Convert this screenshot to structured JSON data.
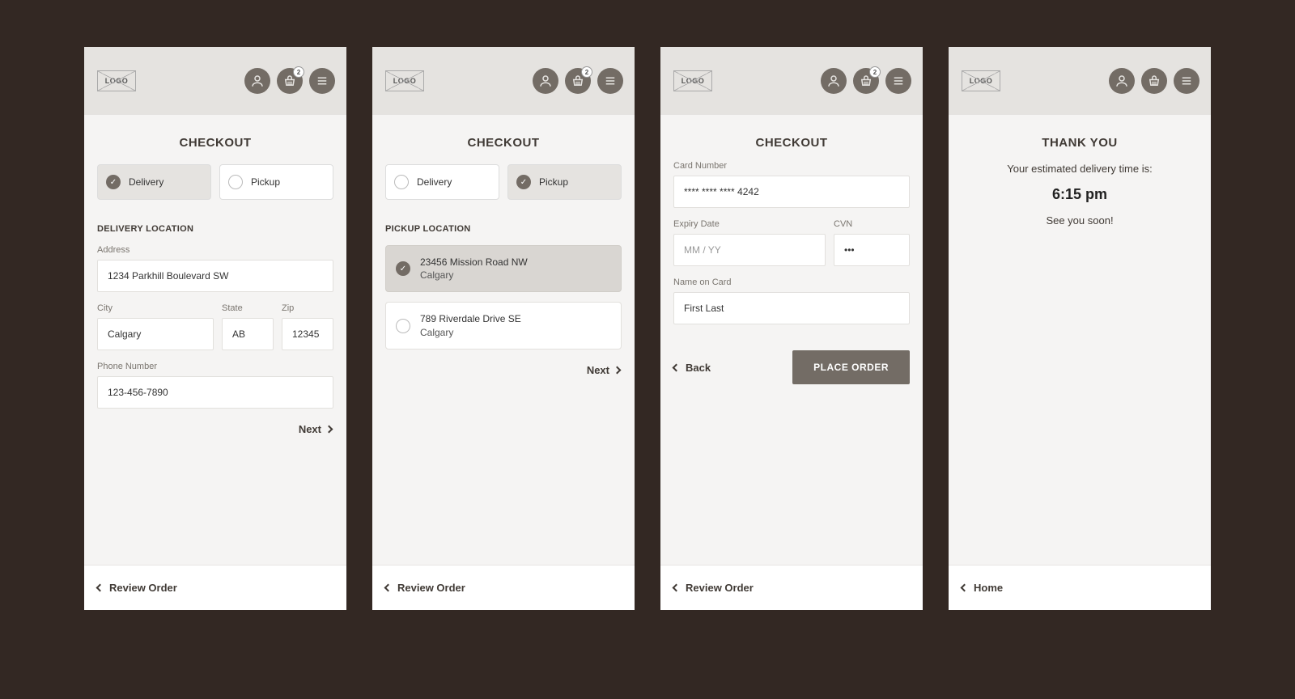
{
  "common": {
    "logo_text": "LOGO",
    "cart_badge": "2"
  },
  "screen1": {
    "title": "CHECKOUT",
    "seg": {
      "delivery": "Delivery",
      "pickup": "Pickup"
    },
    "section": "DELIVERY LOCATION",
    "address": {
      "label": "Address",
      "value": "1234 Parkhill Boulevard SW"
    },
    "city": {
      "label": "City",
      "value": "Calgary"
    },
    "state": {
      "label": "State",
      "value": "AB"
    },
    "zip": {
      "label": "Zip",
      "value": "12345"
    },
    "phone": {
      "label": "Phone Number",
      "value": "123-456-7890"
    },
    "next": "Next",
    "footer": "Review Order"
  },
  "screen2": {
    "title": "CHECKOUT",
    "seg": {
      "delivery": "Delivery",
      "pickup": "Pickup"
    },
    "section": "PICKUP LOCATION",
    "loc1": {
      "line1": "23456 Mission Road NW",
      "line2": "Calgary"
    },
    "loc2": {
      "line1": "789 Riverdale Drive SE",
      "line2": "Calgary"
    },
    "next": "Next",
    "footer": "Review Order"
  },
  "screen3": {
    "title": "CHECKOUT",
    "card": {
      "label": "Card Number",
      "value": "**** **** **** 4242"
    },
    "exp": {
      "label": "Expiry Date",
      "placeholder": "MM / YY"
    },
    "cvn": {
      "label": "CVN",
      "value": "•••"
    },
    "name": {
      "label": "Name on Card",
      "value": "First Last"
    },
    "back": "Back",
    "place": "PLACE ORDER",
    "footer": "Review Order"
  },
  "screen4": {
    "title": "THANK YOU",
    "sub": "Your estimated delivery time is:",
    "time": "6:15 pm",
    "see": "See you soon!",
    "footer": "Home"
  }
}
